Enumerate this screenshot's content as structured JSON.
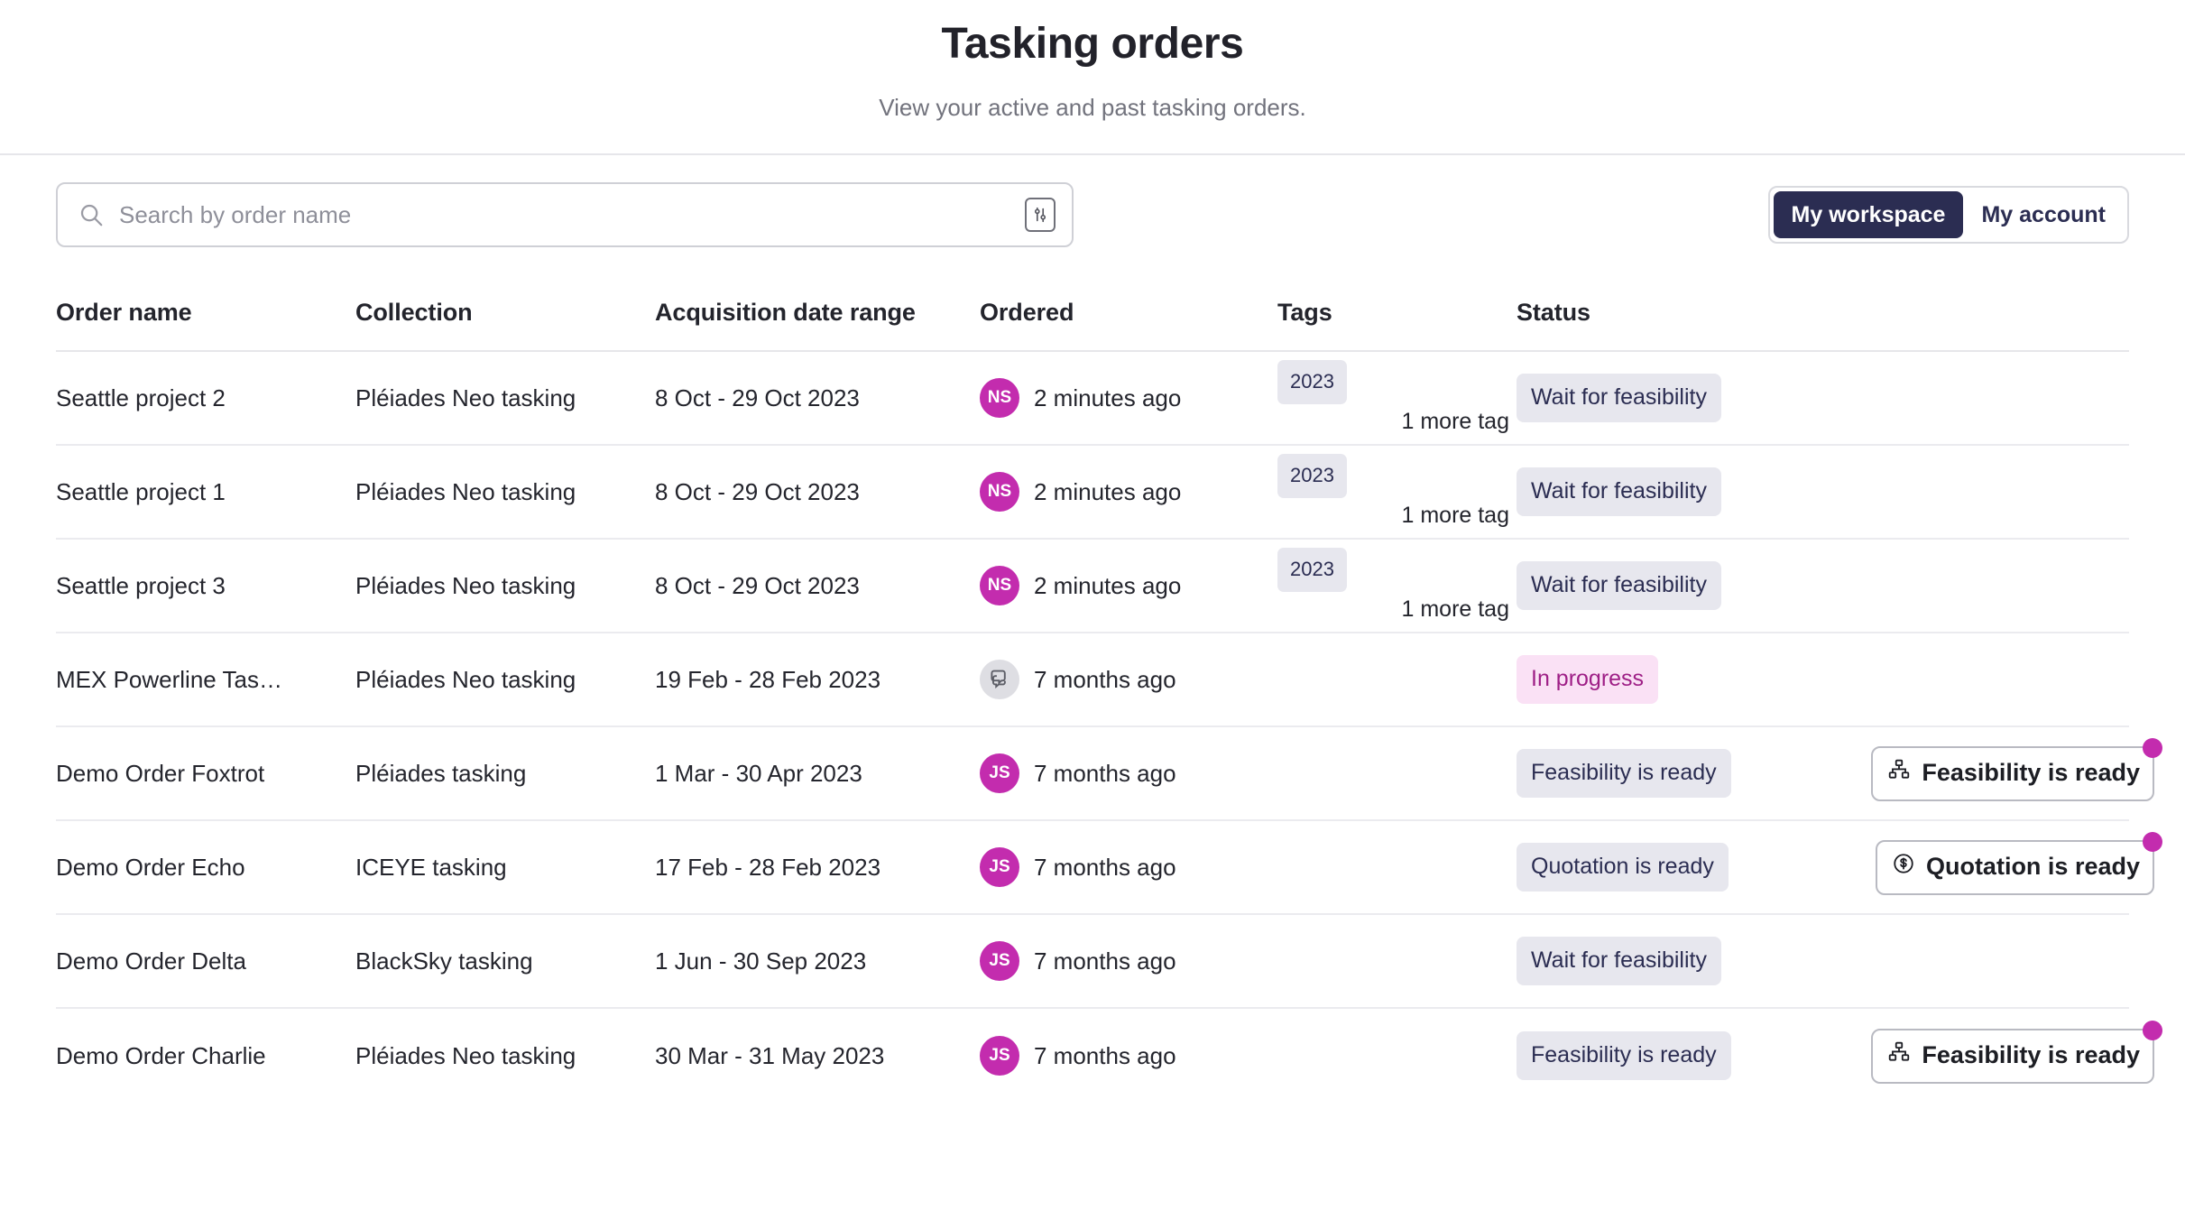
{
  "header": {
    "title": "Tasking orders",
    "subtitle": "View your active and past tasking orders."
  },
  "toolbar": {
    "search_placeholder": "Search by order name",
    "search_value": "",
    "search_icon": "search-icon",
    "filter_icon": "sliders-filter-icon",
    "segments": [
      {
        "label": "My workspace",
        "active": true
      },
      {
        "label": "My account",
        "active": false
      }
    ]
  },
  "table": {
    "columns": [
      "Order name",
      "Collection",
      "Acquisition date range",
      "Ordered",
      "Tags",
      "Status"
    ],
    "rows": [
      {
        "name": "Seattle project 2",
        "collection": "Pléiades Neo tasking",
        "date_range": "8 Oct - 29 Oct 2023",
        "avatar_initials": "NS",
        "avatar_type": "initials",
        "ordered": "2 minutes ago",
        "tag": "2023",
        "more_tags": "1 more tag",
        "status": "Wait for feasibility",
        "status_style": "default",
        "action": null
      },
      {
        "name": "Seattle project 1",
        "collection": "Pléiades Neo tasking",
        "date_range": "8 Oct - 29 Oct 2023",
        "avatar_initials": "NS",
        "avatar_type": "initials",
        "ordered": "2 minutes ago",
        "tag": "2023",
        "more_tags": "1 more tag",
        "status": "Wait for feasibility",
        "status_style": "default",
        "action": null
      },
      {
        "name": "Seattle project 3",
        "collection": "Pléiades Neo tasking",
        "date_range": "8 Oct - 29 Oct 2023",
        "avatar_initials": "NS",
        "avatar_type": "initials",
        "ordered": "2 minutes ago",
        "tag": "2023",
        "more_tags": "1 more tag",
        "status": "Wait for feasibility",
        "status_style": "default",
        "action": null
      },
      {
        "name": "MEX Powerline Tas…",
        "collection": "Pléiades Neo tasking",
        "date_range": "19 Feb - 28 Feb 2023",
        "avatar_initials": "",
        "avatar_type": "chat-icon",
        "ordered": "7 months ago",
        "tag": null,
        "more_tags": null,
        "status": "In progress",
        "status_style": "progress",
        "action": null
      },
      {
        "name": "Demo Order Foxtrot",
        "collection": "Pléiades tasking",
        "date_range": "1 Mar - 30 Apr 2023",
        "avatar_initials": "JS",
        "avatar_type": "initials",
        "ordered": "7 months ago",
        "tag": null,
        "more_tags": null,
        "status": "Feasibility is ready",
        "status_style": "default",
        "action": {
          "label": "Feasibility is ready",
          "icon": "sitemap-icon",
          "badge": true
        }
      },
      {
        "name": "Demo Order Echo",
        "collection": "ICEYE tasking",
        "date_range": "17 Feb - 28 Feb 2023",
        "avatar_initials": "JS",
        "avatar_type": "initials",
        "ordered": "7 months ago",
        "tag": null,
        "more_tags": null,
        "status": "Quotation is ready",
        "status_style": "default",
        "action": {
          "label": "Quotation is ready",
          "icon": "coin-dollar-icon",
          "badge": true
        }
      },
      {
        "name": "Demo Order Delta",
        "collection": "BlackSky tasking",
        "date_range": "1 Jun - 30 Sep 2023",
        "avatar_initials": "JS",
        "avatar_type": "initials",
        "ordered": "7 months ago",
        "tag": null,
        "more_tags": null,
        "status": "Wait for feasibility",
        "status_style": "default",
        "action": null
      },
      {
        "name": "Demo Order Charlie",
        "collection": "Pléiades Neo tasking",
        "date_range": "30 Mar - 31 May 2023",
        "avatar_initials": "JS",
        "avatar_type": "initials",
        "ordered": "7 months ago",
        "tag": null,
        "more_tags": null,
        "status": "Feasibility is ready",
        "status_style": "default",
        "action": {
          "label": "Feasibility is ready",
          "icon": "sitemap-icon",
          "badge": true
        }
      }
    ]
  },
  "colors": {
    "accent_navy": "#2b2d52",
    "accent_magenta": "#c32cae",
    "chip_bg": "#e7e7ee",
    "progress_bg": "#fae1f5",
    "progress_text": "#9e1f86"
  }
}
